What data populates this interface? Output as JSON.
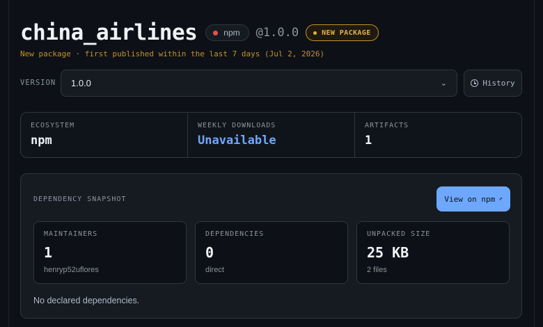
{
  "package": {
    "name": "china_airlines",
    "ecosystem_badge": "npm",
    "version": "@1.0.0",
    "new_badge": "NEW PACKAGE",
    "subtitle": "New package · first published within the last 7 days (Jul 2, 2026)"
  },
  "version_selector": {
    "label": "VERSION",
    "selected": "1.0.0",
    "history_label": "History"
  },
  "stats": [
    {
      "label": "ECOSYSTEM",
      "value": "npm"
    },
    {
      "label": "WEEKLY DOWNLOADS",
      "value": "Unavailable"
    },
    {
      "label": "ARTIFACTS",
      "value": "1"
    }
  ],
  "snapshot": {
    "title": "DEPENDENCY SNAPSHOT",
    "view_button": "View on npm",
    "view_button_icon": "↗",
    "cards": [
      {
        "label": "MAINTAINERS",
        "value": "1",
        "sub": "henryp52uflores"
      },
      {
        "label": "DEPENDENCIES",
        "value": "0",
        "sub": "direct"
      },
      {
        "label": "UNPACKED SIZE",
        "value": "25 KB",
        "sub": "2 files"
      }
    ],
    "note": "No declared dependencies."
  },
  "colors": {
    "background": "#0d1117",
    "accent": "#6ea8fe",
    "warning": "#c69026",
    "ecosystem_dot": "#e5534b"
  }
}
